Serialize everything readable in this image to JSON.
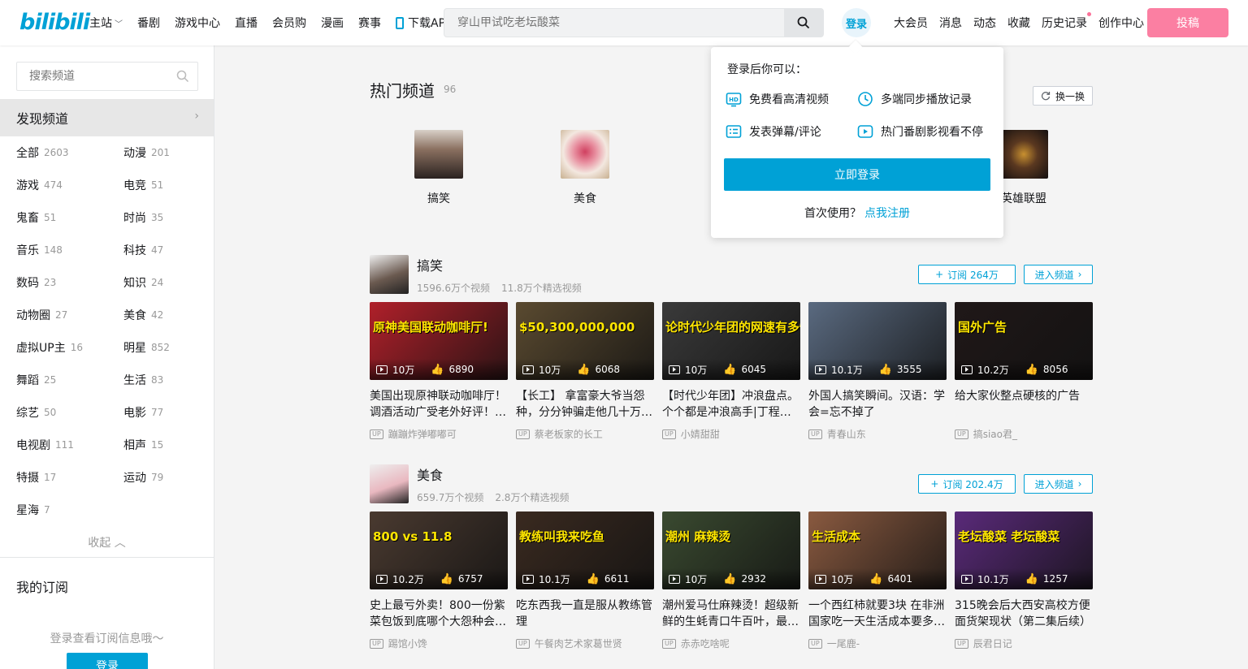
{
  "header": {
    "logo": "bilibili",
    "nav_left": [
      {
        "label": "主站",
        "has_chevron": true
      },
      {
        "label": "番剧"
      },
      {
        "label": "游戏中心"
      },
      {
        "label": "直播"
      },
      {
        "label": "会员购"
      },
      {
        "label": "漫画"
      },
      {
        "label": "赛事"
      },
      {
        "label": "下载APP",
        "icon": "phone-icon"
      }
    ],
    "search_placeholder": "穿山甲试吃老坛酸菜",
    "login_label": "登录",
    "nav_right": [
      {
        "label": "大会员"
      },
      {
        "label": "消息"
      },
      {
        "label": "动态"
      },
      {
        "label": "收藏"
      },
      {
        "label": "历史记录",
        "red_dot": true
      },
      {
        "label": "创作中心"
      }
    ],
    "upload_label": "投稿"
  },
  "sidebar": {
    "search_placeholder": "搜索频道",
    "discover_label": "发现频道",
    "categories": [
      {
        "name": "全部",
        "count": "2603"
      },
      {
        "name": "动漫",
        "count": "201"
      },
      {
        "name": "游戏",
        "count": "474"
      },
      {
        "name": "电竞",
        "count": "51"
      },
      {
        "name": "鬼畜",
        "count": "51"
      },
      {
        "name": "时尚",
        "count": "35"
      },
      {
        "name": "音乐",
        "count": "148"
      },
      {
        "name": "科技",
        "count": "47"
      },
      {
        "name": "数码",
        "count": "23"
      },
      {
        "name": "知识",
        "count": "24"
      },
      {
        "name": "动物圈",
        "count": "27"
      },
      {
        "name": "美食",
        "count": "42"
      },
      {
        "name": "虚拟UP主",
        "count": "16"
      },
      {
        "name": "明星",
        "count": "852"
      },
      {
        "name": "舞蹈",
        "count": "25"
      },
      {
        "name": "生活",
        "count": "83"
      },
      {
        "name": "综艺",
        "count": "50"
      },
      {
        "name": "电影",
        "count": "77"
      },
      {
        "name": "电视剧",
        "count": "111"
      },
      {
        "name": "相声",
        "count": "15"
      },
      {
        "name": "特摄",
        "count": "17"
      },
      {
        "name": "运动",
        "count": "79"
      },
      {
        "name": "星海",
        "count": "7"
      }
    ],
    "collapse_label": "收起",
    "my_subscriptions": "我的订阅",
    "login_tip": "登录查看订阅信息哦～",
    "login_button": "登录"
  },
  "hot": {
    "title": "热门频道",
    "count": "96",
    "refresh_label": "换一换",
    "channels": [
      {
        "name": "搞笑",
        "color": "#6b5a50"
      },
      {
        "name": "美食",
        "color": "#e9b8c0"
      },
      {
        "name": "英雄联盟",
        "color": "#2a2520"
      }
    ]
  },
  "sections": [
    {
      "name": "搞笑",
      "videos_count": "1596.6万个视频",
      "featured_count": "11.8万个精选视频",
      "subscribe_label": "订阅 264万",
      "enter_label": "进入频道",
      "avatar_color": "#6b5a50",
      "cards": [
        {
          "views": "10万",
          "likes": "6890",
          "title": "美国出现原神联动咖啡厅！调酒活动广受老外好评！…",
          "up": "蹦蹦炸弹嘟嘟可",
          "color": "#b0202a",
          "cover_text": "原神美国联动咖啡厅!"
        },
        {
          "views": "10万",
          "likes": "6068",
          "title": "【长工】 拿富豪大爷当怨种，分分钟骗走他几十万…",
          "up": "蔡老板家的长工",
          "color": "#5a4a30",
          "cover_text": "$50,300,000,000"
        },
        {
          "views": "10万",
          "likes": "6045",
          "title": "【时代少年团】冲浪盘点。个个都是冲浪高手|丁程…",
          "up": "小婧甜甜",
          "color": "#3a3a3a",
          "cover_text": "论时代少年团的网速有多快"
        },
        {
          "views": "10.1万",
          "likes": "3555",
          "title": "外国人搞笑瞬间。汉语：学会=忘不掉了",
          "up": "青春山东",
          "color": "#5a6a80",
          "cover_text": ""
        },
        {
          "views": "10.2万",
          "likes": "8056",
          "title": "给大家伙整点硬核的广告",
          "up": "搞siao君_",
          "color": "#201818",
          "cover_text": "国外广告"
        }
      ]
    },
    {
      "name": "美食",
      "videos_count": "659.7万个视频",
      "featured_count": "2.8万个精选视频",
      "subscribe_label": "订阅 202.4万",
      "enter_label": "进入频道",
      "avatar_color": "#e9b8c0",
      "cards": [
        {
          "views": "10.2万",
          "likes": "6757",
          "title": "史上最亏外卖！800一份紫菜包饭到底哪个大怨种会…",
          "up": "踢馆小馋",
          "color": "#4a3a30",
          "cover_text": "800 vs 11.8"
        },
        {
          "views": "10.1万",
          "likes": "6611",
          "title": "吃东西我一直是服从教练管理",
          "up": "午餐肉艺术家葛世贤",
          "color": "#3a2a20",
          "cover_text": "教练叫我来吃鱼"
        },
        {
          "views": "10万",
          "likes": "2932",
          "title": "潮州爱马仕麻辣烫！超级新鲜的生蚝青口牛百叶，最…",
          "up": "赤赤吃啥呢",
          "color": "#3a4a30",
          "cover_text": "潮州     麻辣烫"
        },
        {
          "views": "10万",
          "likes": "6401",
          "title": "一个西红柿就要3块 在非洲国家吃一天生活成本要多…",
          "up": "一尾鹿-",
          "color": "#8a5a40",
          "cover_text": "生活成本"
        },
        {
          "views": "10.1万",
          "likes": "1257",
          "title": "315晚会后大西安高校方便面货架现状（第二集后续）",
          "up": "辰君日记",
          "color": "#5a2a7a",
          "cover_text": "老坛酸菜  老坛酸菜"
        }
      ]
    }
  ],
  "popup": {
    "header": "登录后你可以：",
    "benefits": [
      {
        "icon": "hd-icon",
        "label": "免费看高清视频"
      },
      {
        "icon": "clock-icon",
        "label": "多端同步播放记录"
      },
      {
        "icon": "danmaku-icon",
        "label": "发表弹幕/评论"
      },
      {
        "icon": "tv-icon",
        "label": "热门番剧影视看不停"
      }
    ],
    "login_button": "立即登录",
    "first_use": "首次使用？",
    "register_link": "点我注册"
  }
}
